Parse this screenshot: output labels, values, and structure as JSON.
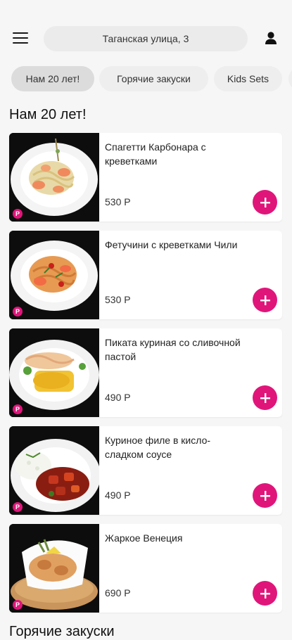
{
  "header": {
    "menu_icon": "hamburger-menu-icon",
    "address": "Таганская улица, 3",
    "profile_icon": "user-icon"
  },
  "categories": [
    {
      "label": "Нам 20 лет!",
      "active": true
    },
    {
      "label": "Горячие закуски",
      "active": false
    },
    {
      "label": "Kids Sets",
      "active": false
    },
    {
      "label": "",
      "active": false
    }
  ],
  "sections": [
    {
      "title": "Нам 20 лет!",
      "items": [
        {
          "name": "Спагетти Карбонара с креветками",
          "price": "530 Р"
        },
        {
          "name": "Фетучини с креветками Чили",
          "price": "530 Р"
        },
        {
          "name": "Пиката куриная со сливочной пастой",
          "price": "490 Р"
        },
        {
          "name": "Куриное филе в кисло-сладком соусе",
          "price": "490 Р"
        },
        {
          "name": "Жаркое Венеция",
          "price": "690 Р"
        }
      ]
    },
    {
      "title": "Горячие закуски",
      "items": []
    }
  ],
  "badge_letter": "P",
  "colors": {
    "accent": "#e0157a",
    "background": "#f6f6f6",
    "card": "#ffffff"
  }
}
